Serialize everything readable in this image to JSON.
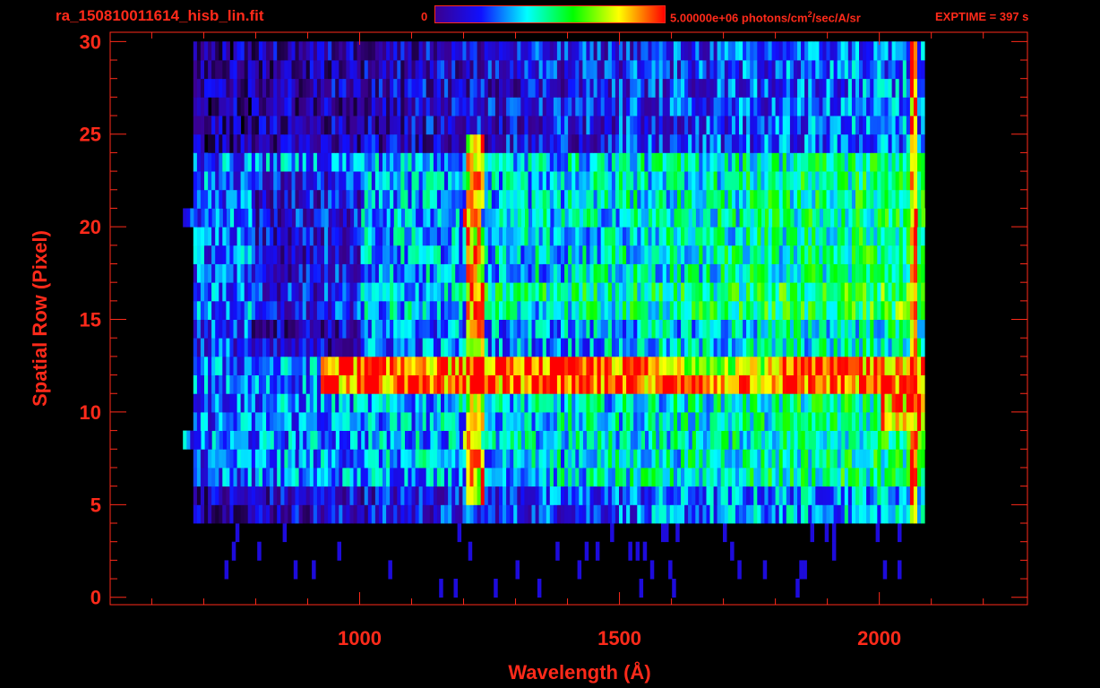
{
  "header": {
    "file_title": "ra_150810011614_hisb_lin.fit",
    "colorbar_min": "0",
    "colorbar_max": "5.00000e+06",
    "colorbar_unit_pre": " photons/cm",
    "colorbar_unit_sup": "2",
    "colorbar_unit_post": "/sec/A/sr",
    "exptime": "EXPTIME = 397 s"
  },
  "colors": {
    "axis": "#ff2a1a",
    "background": "#000000",
    "colormap": [
      "#000000",
      "#3a0090",
      "#1010ff",
      "#00ffff",
      "#00ff00",
      "#ffff00",
      "#ff0000"
    ]
  },
  "chart_data": {
    "type": "heatmap",
    "title": "ra_150810011614_hisb_lin.fit",
    "xlabel": "Wavelength (Å)",
    "ylabel": "Spatial Row (Pixel)",
    "xlim": [
      520,
      2285
    ],
    "ylim": [
      -0.4,
      30.5
    ],
    "xticks": [
      1000,
      1500,
      2000
    ],
    "yticks": [
      0,
      5,
      10,
      15,
      20,
      25,
      30
    ],
    "x_minor_step": 100,
    "y_minor_step": 1,
    "colorbar": {
      "min": 0,
      "max": 5000000,
      "unit": "photons/cm^2/sec/A/sr"
    },
    "data_x_range": [
      680,
      2085
    ],
    "rows": 30,
    "features": [
      {
        "name": "Lyman alpha",
        "x": 1216
      },
      {
        "name": "bright band",
        "rows": [
          11,
          12
        ],
        "x_start": 920,
        "x_end": 2070
      },
      {
        "name": "detector edge",
        "x": 2062
      }
    ]
  }
}
